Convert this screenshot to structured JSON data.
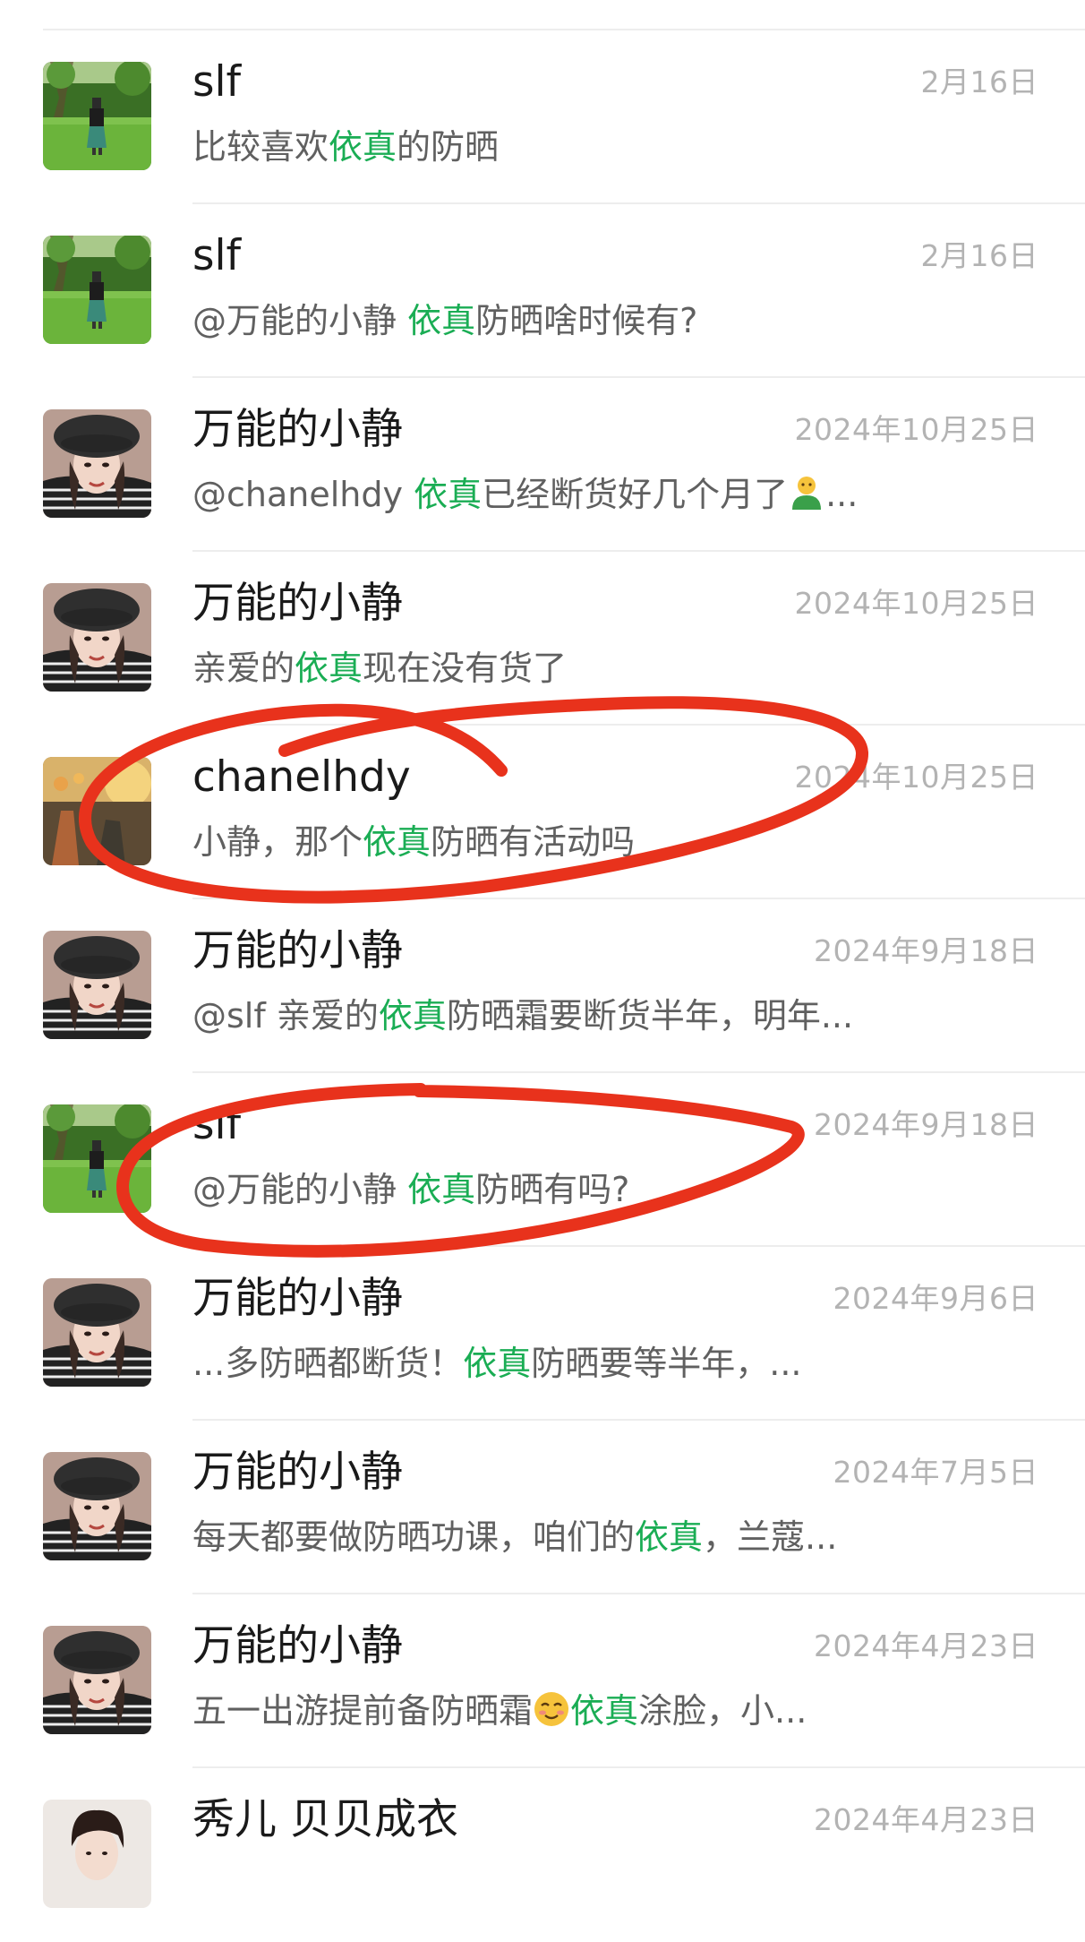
{
  "colors": {
    "highlight": "#1aad54",
    "annotation": "#e8321c"
  },
  "rows": [
    {
      "name": "slf",
      "date": "2月16日",
      "avatar": "slf-avatar",
      "preview": {
        "before": "比较喜欢",
        "keyword": "依真",
        "after": "的防晒"
      }
    },
    {
      "name": "slf",
      "date": "2月16日",
      "avatar": "slf-avatar",
      "preview": {
        "before": "@万能的小静 ",
        "keyword": "依真",
        "after": "防晒啥时候有?"
      }
    },
    {
      "name": "万能的小静",
      "date": "2024年10月25日",
      "avatar": "xiaojing-avatar",
      "preview": {
        "before": "@chanelhdy ",
        "keyword": "依真",
        "after": "已经断货好几个月了",
        "emoji": "person-emoji",
        "tail": "..."
      }
    },
    {
      "name": "万能的小静",
      "date": "2024年10月25日",
      "avatar": "xiaojing-avatar",
      "preview": {
        "before": "亲爱的",
        "keyword": "依真",
        "after": "现在没有货了"
      }
    },
    {
      "name": "chanelhdy",
      "date": "2024年10月25日",
      "avatar": "chanelhdy-avatar",
      "preview": {
        "before": "小静，那个",
        "keyword": "依真",
        "after": "防晒有活动吗"
      }
    },
    {
      "name": "万能的小静",
      "date": "2024年9月18日",
      "avatar": "xiaojing-avatar",
      "preview": {
        "before": "@slf 亲爱的",
        "keyword": "依真",
        "after": "防晒霜要断货半年，明年..."
      }
    },
    {
      "name": "slf",
      "date": "2024年9月18日",
      "avatar": "slf-avatar",
      "preview": {
        "before": "@万能的小静 ",
        "keyword": "依真",
        "after": "防晒有吗?"
      }
    },
    {
      "name": "万能的小静",
      "date": "2024年9月6日",
      "avatar": "xiaojing-avatar",
      "preview": {
        "before": "...多防晒都断货！",
        "keyword": "依真",
        "after": "防晒要等半年，..."
      }
    },
    {
      "name": "万能的小静",
      "date": "2024年7月5日",
      "avatar": "xiaojing-avatar",
      "preview": {
        "before": "每天都要做防晒功课，咱们的",
        "keyword": "依真",
        "after": "，兰蔻..."
      }
    },
    {
      "name": "万能的小静",
      "date": "2024年4月23日",
      "avatar": "xiaojing-avatar",
      "preview": {
        "before": "五一出游提前备防晒霜",
        "emoji_mid": "blush-emoji",
        "keyword": "依真",
        "after": "涂脸，小..."
      }
    },
    {
      "name": "秀儿 贝贝成衣",
      "date": "2024年4月23日",
      "avatar": "xiuer-avatar",
      "preview": {
        "before": "",
        "keyword": "",
        "after": ""
      }
    }
  ]
}
